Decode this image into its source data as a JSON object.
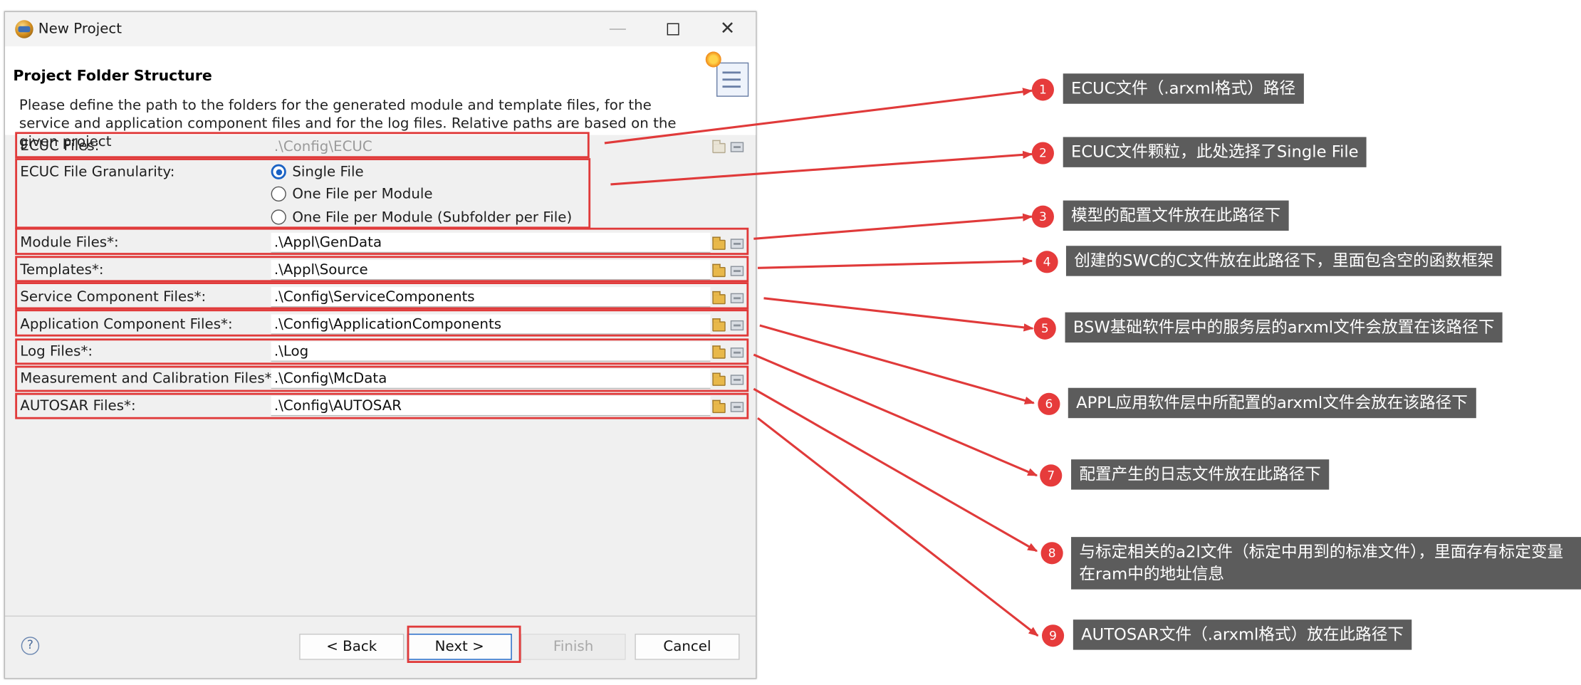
{
  "window": {
    "title": "New Project",
    "minimize_glyph": "—",
    "close_glyph": "✕"
  },
  "banner": {
    "title": "Project Folder Structure",
    "description": "Please define the path to the folders for the generated module and template files, for the service and application component files and for the log files. Relative paths are based on the given project"
  },
  "form": {
    "ecuc_files": {
      "label": "ECUC Files:",
      "value": ".\\Config\\ECUC"
    },
    "granularity": {
      "label": "ECUC File Granularity:",
      "options": [
        {
          "label": "Single File",
          "selected": true
        },
        {
          "label": "One File per Module",
          "selected": false
        },
        {
          "label": "One File per Module (Subfolder per File)",
          "selected": false
        }
      ]
    },
    "module_files": {
      "label": "Module Files*:",
      "value": ".\\Appl\\GenData"
    },
    "templates": {
      "label": "Templates*:",
      "value": ".\\Appl\\Source"
    },
    "service_component_files": {
      "label": "Service Component Files*:",
      "value": ".\\Config\\ServiceComponents"
    },
    "application_component_files": {
      "label": "Application Component Files*:",
      "value": ".\\Config\\ApplicationComponents"
    },
    "log_files": {
      "label": "Log Files*:",
      "value": ".\\Log"
    },
    "mc_files": {
      "label": "Measurement and Calibration Files*:",
      "value": ".\\Config\\McData"
    },
    "autosar_files": {
      "label": "AUTOSAR Files*:",
      "value": ".\\Config\\AUTOSAR"
    }
  },
  "footer": {
    "help_glyph": "?",
    "back": "< Back",
    "next": "Next >",
    "finish": "Finish",
    "cancel": "Cancel"
  },
  "annotations": [
    {
      "num": "1",
      "text": "ECUC文件（.arxml格式）路径"
    },
    {
      "num": "2",
      "text": "ECUC文件颗粒，此处选择了Single File"
    },
    {
      "num": "3",
      "text": "模型的配置文件放在此路径下"
    },
    {
      "num": "4",
      "text": "创建的SWC的C文件放在此路径下，里面包含空的函数框架"
    },
    {
      "num": "5",
      "text": "BSW基础软件层中的服务层的arxml文件会放置在该路径下"
    },
    {
      "num": "6",
      "text": "APPL应用软件层中所配置的arxml文件会放在该路径下"
    },
    {
      "num": "7",
      "text": "配置产生的日志文件放在此路径下"
    },
    {
      "num": "8",
      "text": "与标定相关的a2l文件（标定中用到的标准文件），里面存有标定变量在ram中的地址信息"
    },
    {
      "num": "9",
      "text": "AUTOSAR文件（.arxml格式）放在此路径下"
    }
  ],
  "colors": {
    "annotation_red": "#e03a3a",
    "callout_bg": "#5c5c5c",
    "selection_blue": "#1a62c4"
  }
}
